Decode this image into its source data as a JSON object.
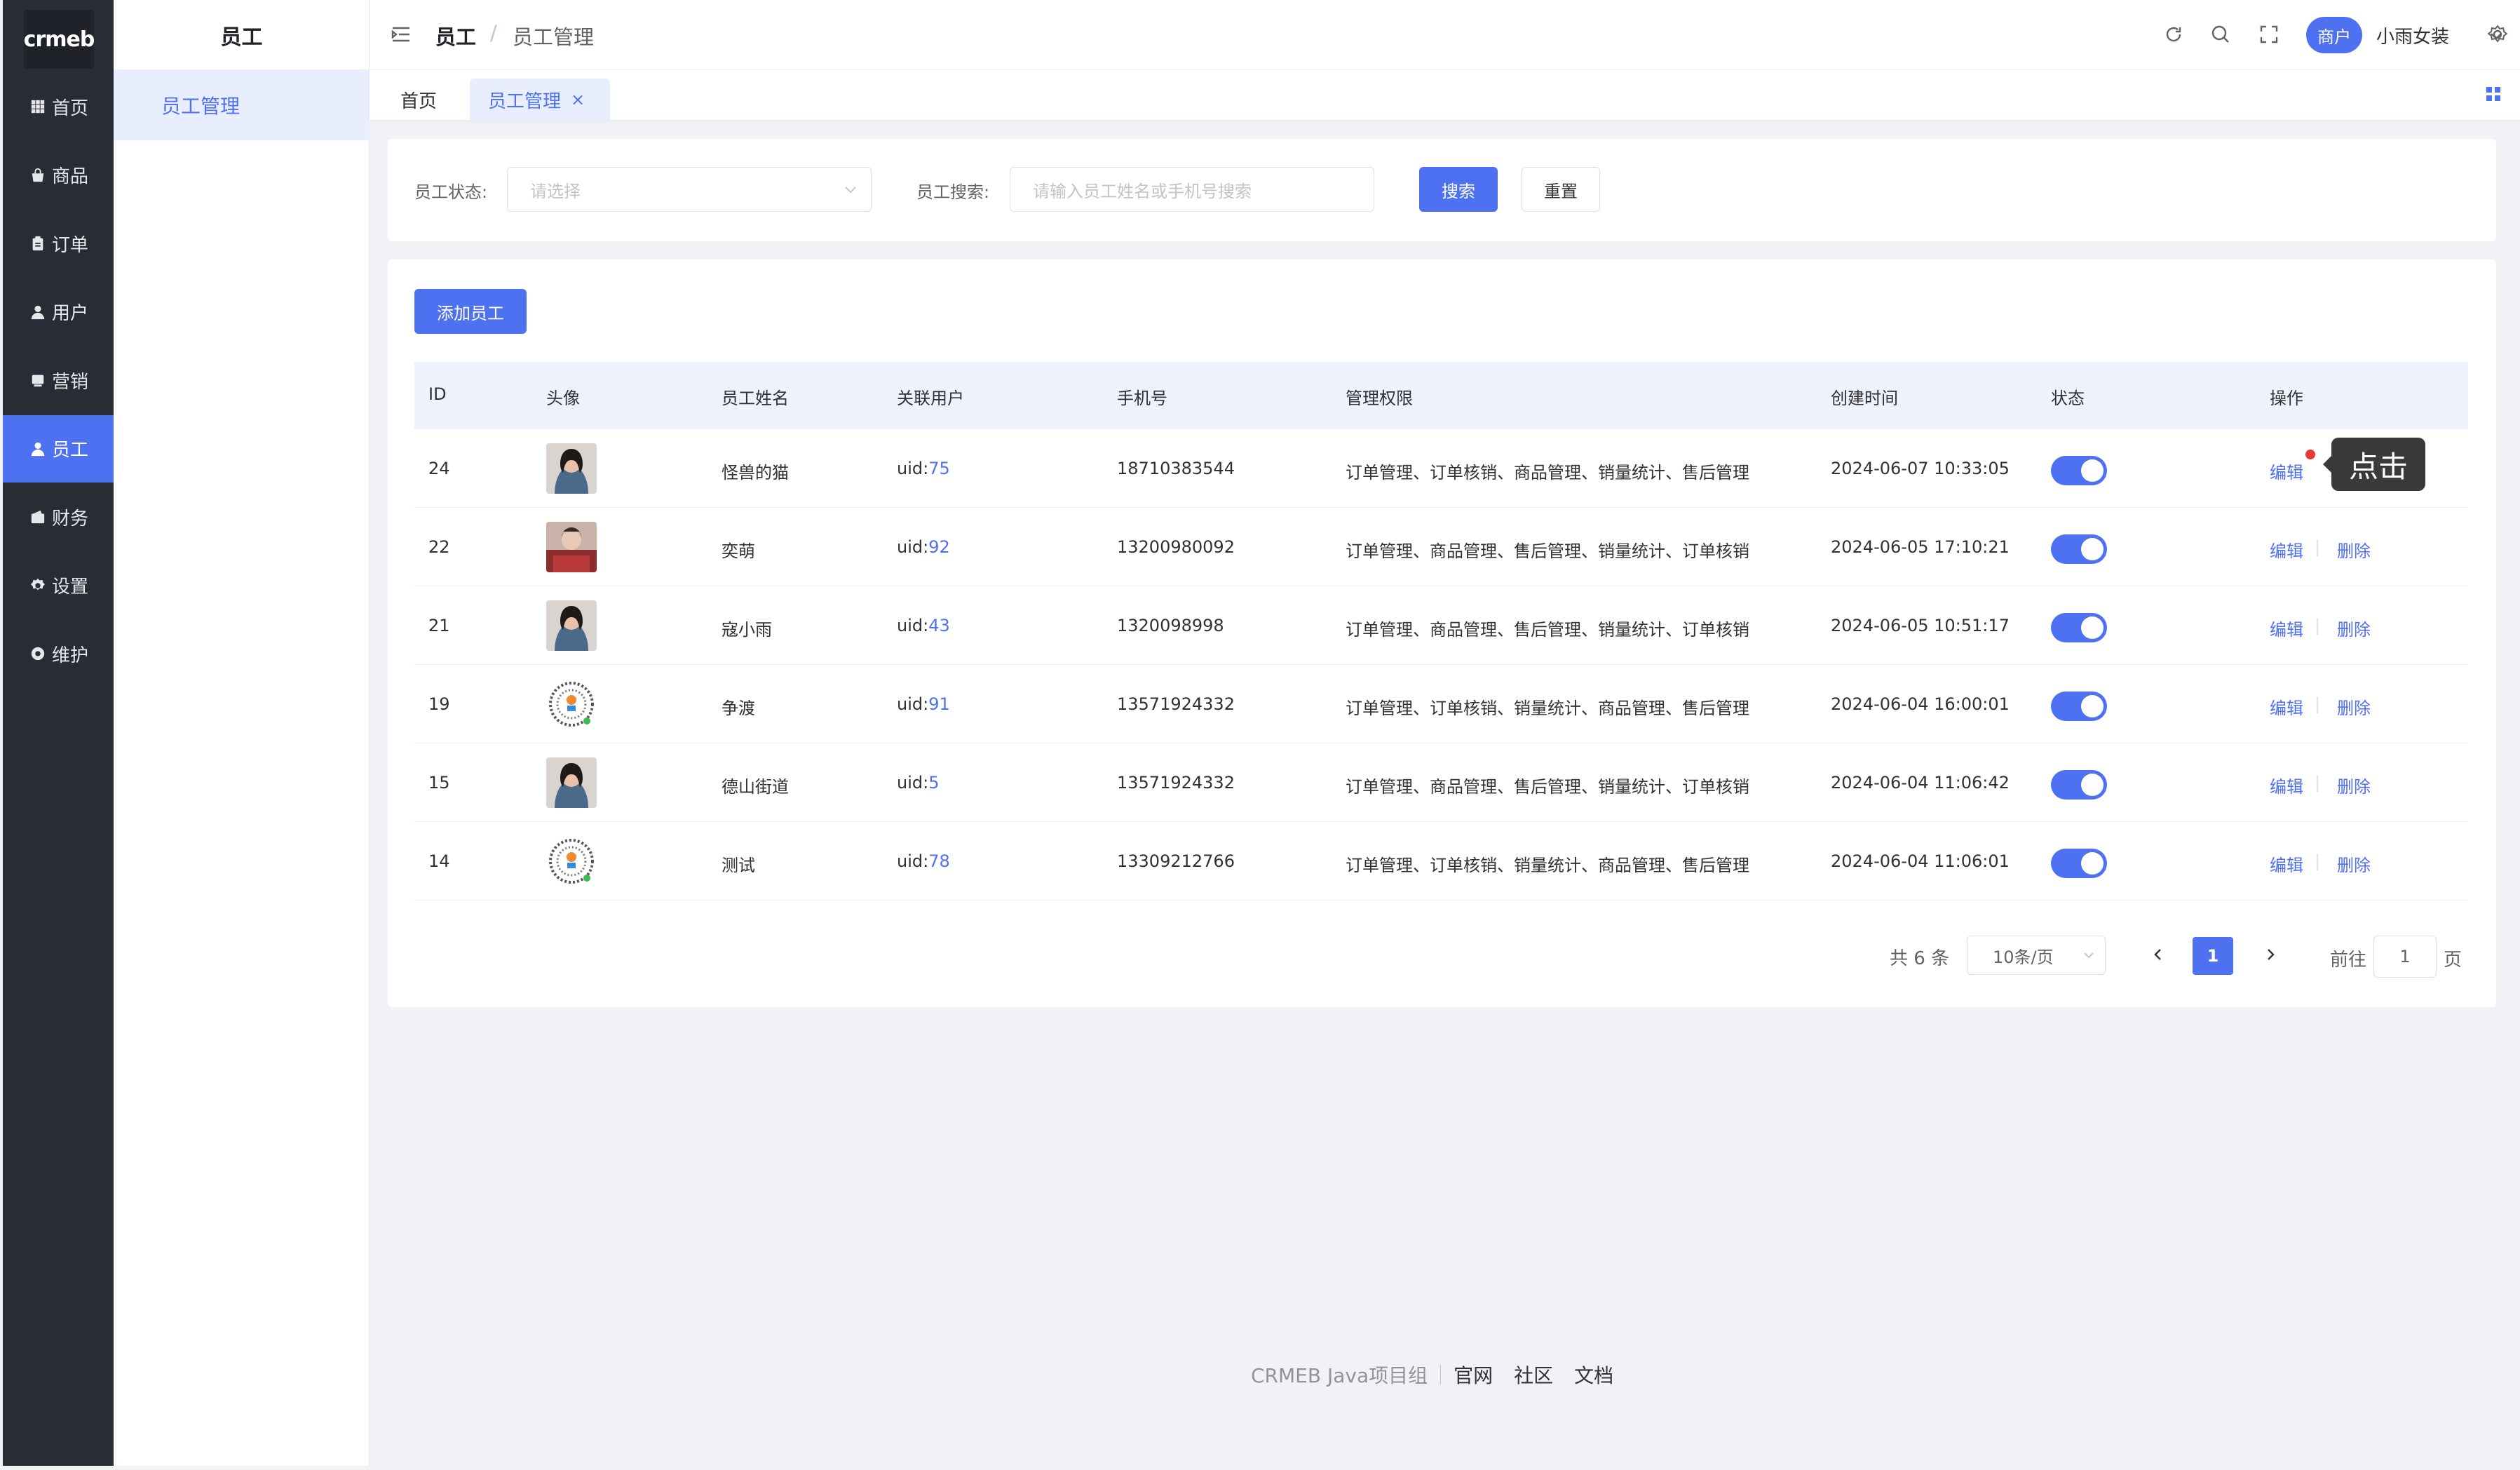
{
  "logo": {
    "text": "crmeb"
  },
  "sidebar": {
    "items": [
      {
        "label": "首页",
        "icon": "grid-icon"
      },
      {
        "label": "商品",
        "icon": "bag-icon"
      },
      {
        "label": "订单",
        "icon": "clipboard-icon"
      },
      {
        "label": "用户",
        "icon": "user-icon"
      },
      {
        "label": "营销",
        "icon": "card-icon"
      },
      {
        "label": "员工",
        "icon": "user-icon",
        "active": true
      },
      {
        "label": "财务",
        "icon": "wallet-icon"
      },
      {
        "label": "设置",
        "icon": "gear-icon"
      },
      {
        "label": "维护",
        "icon": "settings-icon"
      }
    ]
  },
  "submenu": {
    "title": "员工",
    "item": "员工管理"
  },
  "header": {
    "breadcrumb_1": "员工",
    "breadcrumb_sep": "/",
    "breadcrumb_2": "员工管理",
    "merchant_badge": "商户",
    "store_name": "小雨女装"
  },
  "tabs": {
    "home": "首页",
    "staff": "员工管理",
    "close": "×"
  },
  "search": {
    "status_label": "员工状态:",
    "status_placeholder": "请选择",
    "keyword_label": "员工搜索:",
    "keyword_placeholder": "请输入员工姓名或手机号搜索",
    "search_button": "搜索",
    "reset_button": "重置"
  },
  "table": {
    "add_button": "添加员工",
    "headers": [
      "ID",
      "头像",
      "员工姓名",
      "关联用户",
      "手机号",
      "管理权限",
      "创建时间",
      "状态",
      "操作"
    ],
    "uid_prefix": "uid:",
    "edit_label": "编辑",
    "sep": "|",
    "delete_label": "删除",
    "rows": [
      {
        "id": "24",
        "name": "怪兽的猫",
        "uid": "75",
        "phone": "18710383544",
        "perms": "订单管理、订单核销、商品管理、销量统计、售后管理",
        "created": "2024-06-07 10:33:05",
        "status_on": true,
        "avatar": "portrait"
      },
      {
        "id": "22",
        "name": "奕萌",
        "uid": "92",
        "phone": "13200980092",
        "perms": "订单管理、商品管理、售后管理、销量统计、订单核销",
        "created": "2024-06-05 17:10:21",
        "status_on": true,
        "avatar": "photo"
      },
      {
        "id": "21",
        "name": "寇小雨",
        "uid": "43",
        "phone": "1320098998",
        "perms": "订单管理、商品管理、售后管理、销量统计、订单核销",
        "created": "2024-06-05 10:51:17",
        "status_on": true,
        "avatar": "portrait"
      },
      {
        "id": "19",
        "name": "争渡",
        "uid": "91",
        "phone": "13571924332",
        "perms": "订单管理、订单核销、销量统计、商品管理、售后管理",
        "created": "2024-06-04 16:00:01",
        "status_on": true,
        "avatar": "qr"
      },
      {
        "id": "15",
        "name": "德山街道",
        "uid": "5",
        "phone": "13571924332",
        "perms": "订单管理、商品管理、售后管理、销量统计、订单核销",
        "created": "2024-06-04 11:06:42",
        "status_on": true,
        "avatar": "portrait"
      },
      {
        "id": "14",
        "name": "测试",
        "uid": "78",
        "phone": "13309212766",
        "perms": "订单管理、订单核销、销量统计、商品管理、售后管理",
        "created": "2024-06-04 11:06:01",
        "status_on": true,
        "avatar": "qr"
      }
    ]
  },
  "pagination": {
    "total": "共 6 条",
    "page_size": "10条/页",
    "current": "1",
    "goto_label": "前往",
    "goto_value": "1",
    "page_suffix": "页"
  },
  "tooltip": {
    "text": "点击"
  },
  "footer": {
    "team": "CRMEB Java项目组",
    "links": [
      "官网",
      "社区",
      "文档"
    ]
  },
  "colors": {
    "primary": "#4e71f2",
    "sidebar_bg": "#282c34",
    "page_bg": "#f0f2f5"
  }
}
